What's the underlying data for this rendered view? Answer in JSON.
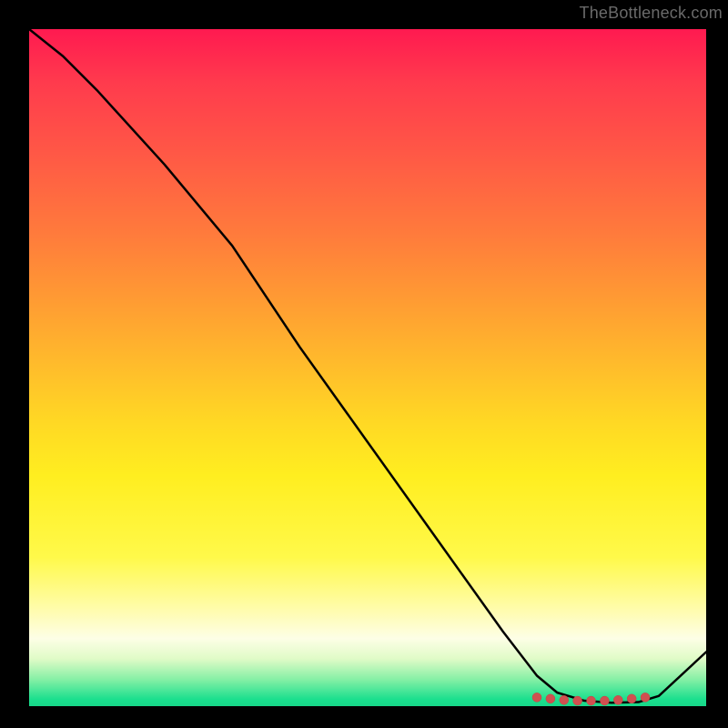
{
  "attribution": "TheBottleneck.com",
  "chart_data": {
    "type": "line",
    "title": "",
    "xlabel": "",
    "ylabel": "",
    "xlim": [
      0,
      100
    ],
    "ylim": [
      0,
      100
    ],
    "gradient_note": "vertical red→yellow→green heat gradient",
    "series": [
      {
        "name": "curve",
        "x": [
          0,
          5,
          10,
          20,
          30,
          40,
          50,
          60,
          70,
          75,
          78,
          82,
          86,
          90,
          93,
          100
        ],
        "y": [
          100,
          96,
          91,
          80,
          68,
          53,
          39,
          25,
          11,
          4.5,
          2,
          0.8,
          0.5,
          0.6,
          1.5,
          8
        ]
      }
    ],
    "markers": {
      "name": "bottom-cluster",
      "points": [
        {
          "x": 75,
          "y": 1.3
        },
        {
          "x": 77,
          "y": 1.1
        },
        {
          "x": 79,
          "y": 0.9
        },
        {
          "x": 81,
          "y": 0.8
        },
        {
          "x": 83,
          "y": 0.8
        },
        {
          "x": 85,
          "y": 0.8
        },
        {
          "x": 87,
          "y": 0.9
        },
        {
          "x": 89,
          "y": 1.1
        },
        {
          "x": 91,
          "y": 1.3
        }
      ]
    }
  }
}
